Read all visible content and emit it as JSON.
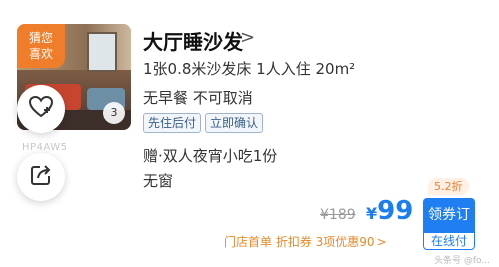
{
  "thumbnail": {
    "badge": "猜您\n喜欢",
    "badge_line1": "猜您",
    "badge_line2": "喜欢",
    "photo_count": "3"
  },
  "watermark": "HP4AW5",
  "room": {
    "title": "大厅睡沙发",
    "title_arrow": ">",
    "bed_info": "1张0.8米沙发床  1人入住  20m²",
    "meal_policy": "无早餐  不可取消",
    "tags": [
      "先住后付",
      "立即确认"
    ],
    "gift": "赠·双人夜宵小吃1份",
    "window": "无窗"
  },
  "pricing": {
    "discount_badge": "5.2折",
    "original_price": "¥189",
    "currency": "¥",
    "price": "99",
    "book_label": "领券订",
    "pay_label": "在线付",
    "promo_text": "门店首单 折扣券 3项优惠90",
    "promo_arrow": ">"
  },
  "attribution": "头条号 @fo..."
}
